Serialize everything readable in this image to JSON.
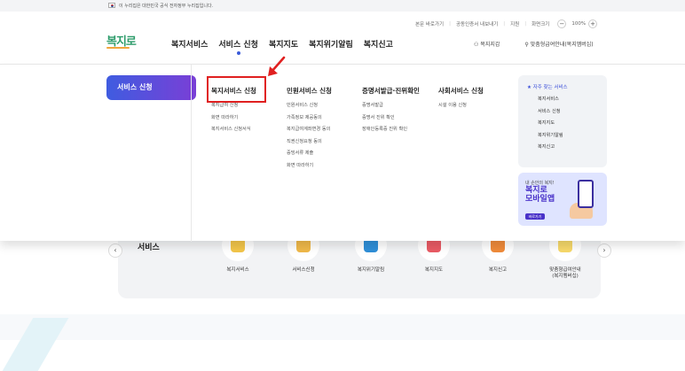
{
  "gov_bar": {
    "text": "이 누리집은 대한민국 공식 전자정부 누리집입니다."
  },
  "util": {
    "links": [
      "본문 바로가기",
      "공동인증서 내보내기",
      "지원",
      "화면크기"
    ],
    "zoom_minus": "−",
    "zoom_value": "100%",
    "zoom_plus": "+"
  },
  "header": {
    "logo": "복지로",
    "gnb": [
      "복지서비스",
      "서비스 신청",
      "복지지도",
      "복지위기알림",
      "복지신고"
    ],
    "active_index": 1,
    "right_links": [
      "복지지갑",
      "맞춤형급여안내(복지멤버십)"
    ]
  },
  "mega": {
    "side_button": "서비스 신청",
    "columns": [
      {
        "head": "복지서비스 신청",
        "items": [
          "복지급여 신청",
          "화면 따라하기",
          "복지서비스 신청서식"
        ]
      },
      {
        "head": "민원서비스 신청",
        "items": [
          "민원서비스 신청",
          "가족정보 제공동의",
          "복지급여계좌변경 동의",
          "직권신청요청 동의",
          "증빙서류 제출",
          "화면 따라하기"
        ]
      },
      {
        "head": "증명서발급·진위확인",
        "items": [
          "증명서발급",
          "증명서 진위 확인",
          "장애인등록증 진위 확인"
        ]
      },
      {
        "head": "사회서비스 신청",
        "items": [
          "시설 이용 신청"
        ]
      }
    ],
    "favorites": {
      "title": "자주 찾는 서비스",
      "items": [
        "복지서비스",
        "서비스 신청",
        "복지지도",
        "복지위기알림",
        "복지신고"
      ]
    },
    "banner": {
      "small": "내 손안의 복지!",
      "big": "복지로\n모바일앱",
      "button": "바로가기"
    }
  },
  "services": {
    "label": "서비스",
    "prev": "‹",
    "next": "›",
    "items": [
      {
        "label": "복지서비스",
        "color": "#f3c64a"
      },
      {
        "label": "서비스신청",
        "color": "#f0b94a"
      },
      {
        "label": "복지위기알림",
        "color": "#2f8fd8"
      },
      {
        "label": "복지지도",
        "color": "#ea5b64"
      },
      {
        "label": "복지신고",
        "color": "#f08b3a"
      },
      {
        "label": "맞춤형급여안내\n(복지멤버십)",
        "color": "#f7d96a"
      }
    ]
  },
  "colors": {
    "accent": "#3f5ce0",
    "highlight": "#e02020",
    "brand": "#2d9c6b"
  }
}
